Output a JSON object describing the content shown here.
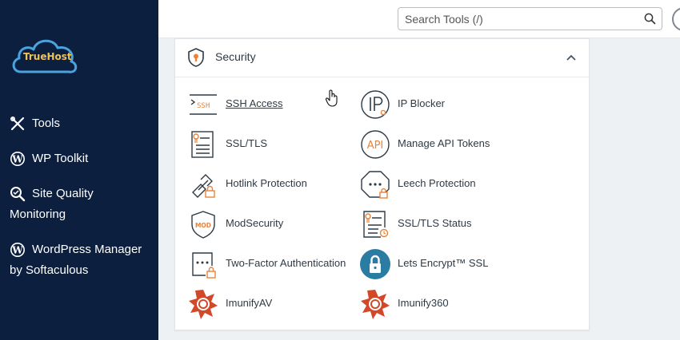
{
  "brand": {
    "logo_text": "TrueHost"
  },
  "sidebar": {
    "items": [
      {
        "label": "Tools",
        "icon": "tools-icon"
      },
      {
        "label": "WP Toolkit",
        "icon": "wordpress-icon"
      },
      {
        "label": "Site Quality",
        "label2": "Monitoring",
        "icon": "magnifier-icon"
      },
      {
        "label": "WordPress Manager",
        "label2": "by Softaculous",
        "icon": "wordpress-icon"
      }
    ]
  },
  "search": {
    "placeholder": "Search Tools (/)"
  },
  "panel": {
    "title": "Security",
    "tools_left": [
      {
        "label": "SSH Access",
        "icon": "ssh-icon"
      },
      {
        "label": "SSL/TLS",
        "icon": "certificate-icon"
      },
      {
        "label": "Hotlink Protection",
        "icon": "hotlink-lock-icon"
      },
      {
        "label": "ModSecurity",
        "icon": "modsecurity-shield-icon"
      },
      {
        "label": "Two-Factor Authentication",
        "icon": "two-factor-icon"
      },
      {
        "label": "ImunifyAV",
        "icon": "imunify-icon"
      }
    ],
    "tools_right": [
      {
        "label": "IP Blocker",
        "icon": "ip-blocker-icon"
      },
      {
        "label": "Manage API Tokens",
        "icon": "api-icon"
      },
      {
        "label": "Leech Protection",
        "icon": "leech-protection-icon"
      },
      {
        "label": "SSL/TLS Status",
        "icon": "certificate-status-icon"
      },
      {
        "label": "Lets Encrypt™ SSL",
        "icon": "lets-encrypt-icon"
      },
      {
        "label": "Imunify360",
        "icon": "imunify360-icon"
      }
    ]
  },
  "colors": {
    "sidebar": "#0c1f3f",
    "accent_orange": "#e8843a",
    "logo_blue": "#4aa3df"
  }
}
